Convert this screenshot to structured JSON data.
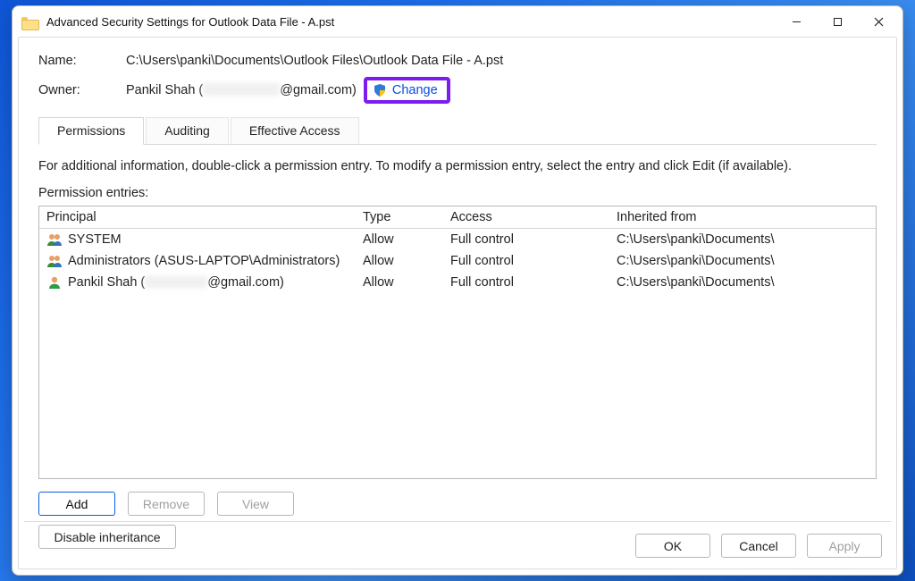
{
  "titlebar": {
    "title": "Advanced Security Settings for Outlook Data File - A.pst"
  },
  "info": {
    "name_label": "Name:",
    "name_value": "C:\\Users\\panki\\Documents\\Outlook Files\\Outlook Data File - A.pst",
    "owner_label": "Owner:",
    "owner_prefix": "Pankil Shah (",
    "owner_suffix": "@gmail.com)",
    "change_label": "Change"
  },
  "tabs": [
    {
      "label": "Permissions",
      "active": true
    },
    {
      "label": "Auditing",
      "active": false
    },
    {
      "label": "Effective Access",
      "active": false
    }
  ],
  "intro": "For additional information, double-click a permission entry. To modify a permission entry, select the entry and click Edit (if available).",
  "entries_heading": "Permission entries:",
  "columns": {
    "principal": "Principal",
    "type": "Type",
    "access": "Access",
    "inherited": "Inherited from"
  },
  "entries": [
    {
      "icon": "group",
      "principal": "SYSTEM",
      "type": "Allow",
      "access": "Full control",
      "inherited": "C:\\Users\\panki\\Documents\\"
    },
    {
      "icon": "group",
      "principal": "Administrators (ASUS-LAPTOP\\Administrators)",
      "type": "Allow",
      "access": "Full control",
      "inherited": "C:\\Users\\panki\\Documents\\"
    },
    {
      "icon": "user",
      "principal_prefix": "Pankil Shah (",
      "principal_suffix": "@gmail.com)",
      "redacted": true,
      "type": "Allow",
      "access": "Full control",
      "inherited": "C:\\Users\\panki\\Documents\\"
    }
  ],
  "buttons": {
    "add": "Add",
    "remove": "Remove",
    "view": "View",
    "disable_inheritance": "Disable inheritance",
    "ok": "OK",
    "cancel": "Cancel",
    "apply": "Apply"
  }
}
